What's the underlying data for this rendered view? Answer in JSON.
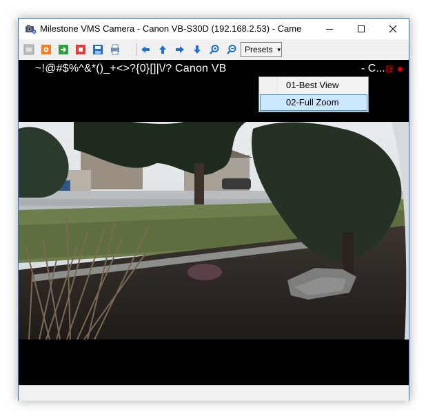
{
  "window": {
    "title": "Milestone VMS Camera  -  Canon VB-S30D (192.168.2.53) - Came...",
    "icon": "camera-app-icon"
  },
  "title_buttons": [
    "minimize-icon",
    "maximize-icon",
    "close-icon"
  ],
  "toolbar": {
    "icons": [
      "snapshot-icon",
      "settings-icon",
      "export-icon",
      "stop-icon",
      "save-icon",
      "print-icon",
      "pan-left-icon",
      "pan-up-icon",
      "pan-right-icon",
      "pan-down-icon",
      "zoom-in-icon",
      "zoom-out-icon"
    ],
    "presets_label": "Presets"
  },
  "video": {
    "overlay_text": "~!@#$%^&*()_+<>?{0}[]|\\/? Canon VB",
    "overlay_right": "- C...",
    "rec_glyph": "録",
    "rec_color": "#e00000"
  },
  "presets_menu": {
    "items": [
      "01-Best View",
      "02-Full Zoom"
    ],
    "highlighted_index": 1,
    "highlight_color": "#cce8ff"
  }
}
